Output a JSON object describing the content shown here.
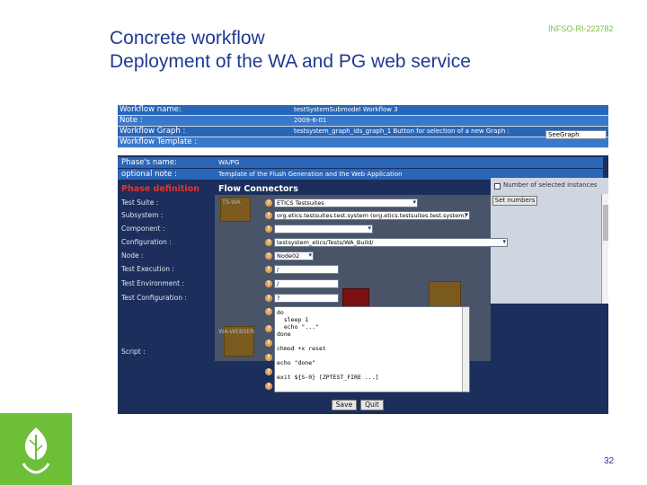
{
  "slide": {
    "title_line1": "Concrete workflow",
    "title_line2": "Deployment of the WA and PG web service",
    "project_code": "INFSO-RI-223782",
    "page_number": "32"
  },
  "workflow": {
    "rows": [
      {
        "label": "Workflow name:",
        "value": "testSystemSubmodel Workflow 3"
      },
      {
        "label": "Note :",
        "value": "2009-6-01"
      },
      {
        "label": "Workflow Graph :",
        "value": "testsystem_graph_ids_graph_1        Button for selection of a new Graph :"
      },
      {
        "label": "Workflow Template :",
        "value": ""
      }
    ],
    "graph_select_value": "SeeGraph"
  },
  "phase": {
    "name_label": "Phase's name:",
    "name_value": "WA/PG",
    "note_label": "optional note :",
    "note_value": "Template of the Flush Generation and the Web Application"
  },
  "tabs": [
    {
      "label": "Phase definition"
    },
    {
      "label": "Flow Connectors"
    }
  ],
  "right_panel": {
    "checkbox_label": "Number of selected instances",
    "button_label": "Set numbers"
  },
  "graph": {
    "node_labels": [
      "TS-WA",
      "WA-WEBSER"
    ]
  },
  "form": {
    "labels": {
      "testsuite": "Test Suite :",
      "subsystem": "Subsystem :",
      "component": "Component :",
      "configuration": "Configuration :",
      "node": "Node :",
      "test_suite_cmd": "Test Execution :",
      "test_environment": "Test Environment :",
      "test_configuration": "Test Configuration :",
      "script": "Script :"
    },
    "values": {
      "testsuite": "ETICS Testsuites",
      "subsystem": "org.etics.testsuites.test.system (org.etics.testsuites.test.system)",
      "component": "",
      "configuration": "testsystem_etics/Tests/WA_Build/",
      "node": "Node02",
      "test_suite_cmd": "/",
      "test_environment": "/",
      "test_configuration": "?"
    },
    "script_text": "do\n  sleep 1\n  echo \"...\"\ndone\n\nchmod +x reset\n\necho \"done\"\n\nexit ${S-0} [ZPTEST_FIRE ...]"
  },
  "buttons": {
    "save": "Save",
    "quit": "Quit"
  },
  "colors": {
    "title_blue": "#1f3a93",
    "accent_green": "#6cbf36",
    "header_blue": "#2a66b8",
    "editor_bg": "#1c2e5b",
    "active_tab_red": "#e8322b"
  }
}
